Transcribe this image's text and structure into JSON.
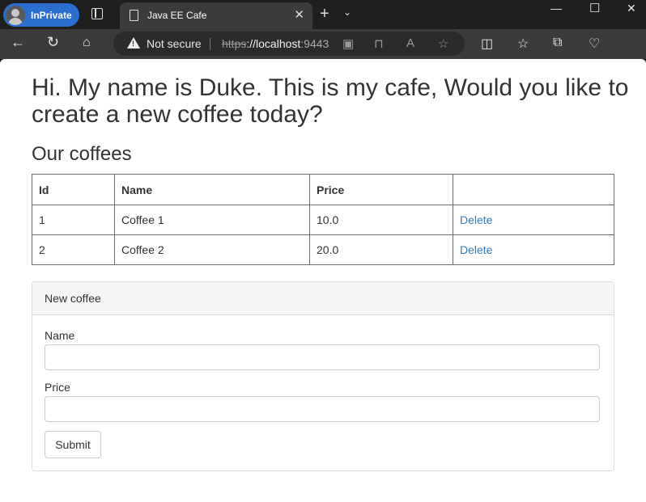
{
  "browser": {
    "inprivate_label": "InPrivate",
    "tab_title": "Java EE Cafe",
    "security_label": "Not secure",
    "url_scheme": "https",
    "url_host": "://localhost",
    "url_port": ":9443"
  },
  "page": {
    "heading": "Hi. My name is Duke. This is my cafe, Would you like to create a new coffee today?",
    "subheading": "Our coffees",
    "table": {
      "headers": [
        "Id",
        "Name",
        "Price",
        ""
      ],
      "rows": [
        {
          "id": "1",
          "name": "Coffee 1",
          "price": "10.0",
          "action": "Delete"
        },
        {
          "id": "2",
          "name": "Coffee 2",
          "price": "20.0",
          "action": "Delete"
        }
      ]
    },
    "form": {
      "title": "New coffee",
      "name_label": "Name",
      "name_value": "",
      "price_label": "Price",
      "price_value": "",
      "submit_label": "Submit"
    }
  }
}
